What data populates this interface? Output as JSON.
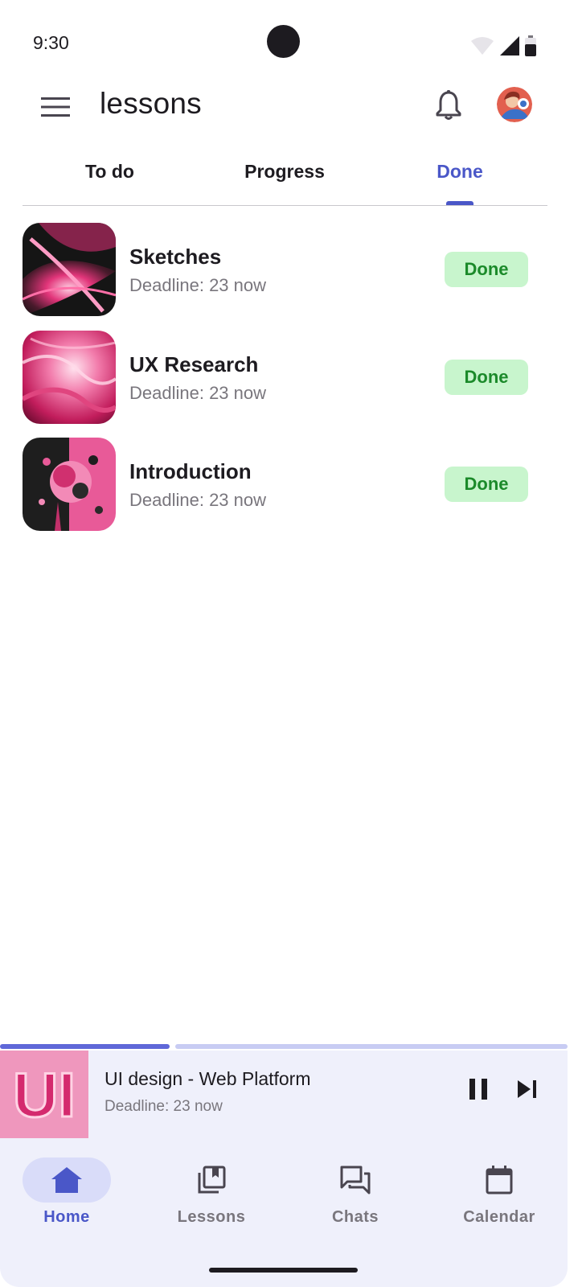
{
  "status_bar": {
    "time": "9:30"
  },
  "app_bar": {
    "title": "lessons"
  },
  "tabs": [
    {
      "label": "To do",
      "active": false
    },
    {
      "label": "Progress",
      "active": false
    },
    {
      "label": "Done",
      "active": true
    }
  ],
  "lessons": [
    {
      "title": "Sketches",
      "subtitle": "Deadline: 23 now",
      "status": "Done"
    },
    {
      "title": "UX Research",
      "subtitle": "Deadline: 23 now",
      "status": "Done"
    },
    {
      "title": "Introduction",
      "subtitle": "Deadline: 23 now",
      "status": "Done"
    }
  ],
  "player": {
    "title": "UI design - Web Platform",
    "subtitle": "Deadline: 23 now",
    "thumb_text": "UI",
    "progress_fraction": 0.3
  },
  "bottom_nav": [
    {
      "label": "Home",
      "icon": "home-icon",
      "active": true
    },
    {
      "label": "Lessons",
      "icon": "library-icon",
      "active": false
    },
    {
      "label": "Chats",
      "icon": "chat-icon",
      "active": false
    },
    {
      "label": "Calendar",
      "icon": "calendar-icon",
      "active": false
    }
  ],
  "colors": {
    "accent": "#4a57c8",
    "done_bg": "#c8f5cd",
    "done_text": "#1b8a2a",
    "nav_bg": "#eff0fb"
  }
}
